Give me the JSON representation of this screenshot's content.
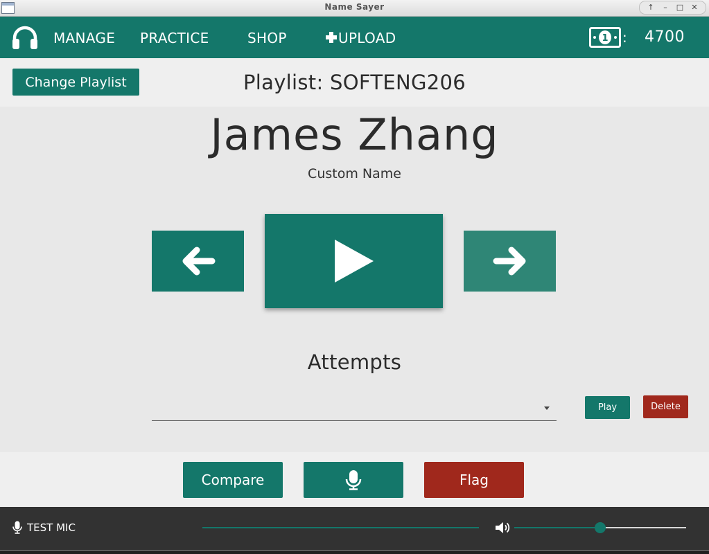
{
  "window": {
    "title": "Name Sayer"
  },
  "nav": {
    "manage": "MANAGE",
    "practice": "PRACTICE",
    "shop": "SHOP",
    "upload": "UPLOAD",
    "money_colon": ":",
    "money_value": "4700"
  },
  "playlist": {
    "change_button": "Change Playlist",
    "title": "Playlist: SOFTENG206"
  },
  "name": {
    "display": "James Zhang",
    "subtitle": "Custom Name"
  },
  "attempts": {
    "title": "Attempts",
    "selected": "",
    "play_button": "Play",
    "delete_button": "Delete"
  },
  "actions": {
    "compare_button": "Compare",
    "flag_button": "Flag"
  },
  "footer": {
    "test_mic_label": "TEST MIC",
    "volume_level": 0.5
  },
  "icons": {
    "nav_logo": "headphones-icon",
    "upload": "plus-icon",
    "money": "banknote-icon",
    "prev": "arrow-left-icon",
    "play": "play-icon",
    "next": "arrow-right-icon",
    "record": "microphone-icon",
    "test_mic": "microphone-icon",
    "volume": "speaker-icon"
  },
  "colors": {
    "primary": "#14776a",
    "danger": "#a0281c",
    "footer": "#323232"
  }
}
